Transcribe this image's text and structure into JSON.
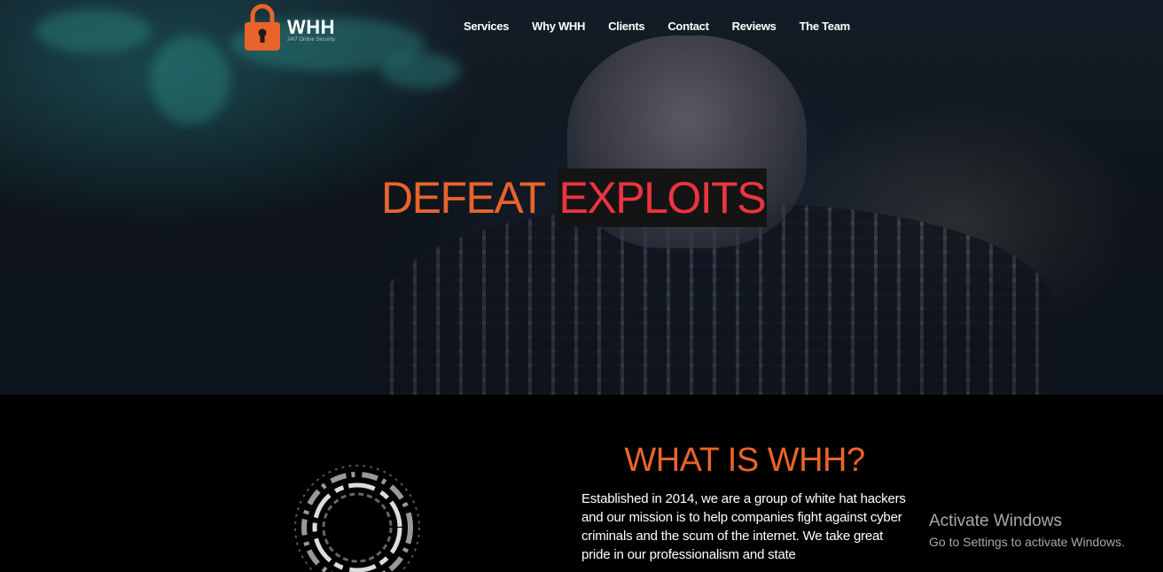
{
  "brand": {
    "name": "WHH",
    "tagline": "24/7 Online Security",
    "accent": "#e8642a"
  },
  "nav": {
    "items": [
      {
        "label": "Services"
      },
      {
        "label": "Why WHH"
      },
      {
        "label": "Clients"
      },
      {
        "label": "Contact"
      },
      {
        "label": "Reviews"
      },
      {
        "label": "The Team"
      }
    ]
  },
  "hero": {
    "headline_part1": "DEFEAT",
    "headline_part2": "EXPLOITS",
    "colors": {
      "part1": "#e8642a",
      "part2": "#ec3440"
    }
  },
  "about": {
    "title": "WHAT IS WHH?",
    "text": "Established in 2014, we are a group of white hat hackers and our mission is to help companies fight against cyber criminals and the scum of the internet. We take great pride in our professionalism and state"
  },
  "watermark": {
    "title": "Activate Windows",
    "subtitle": "Go to Settings to activate Windows."
  }
}
